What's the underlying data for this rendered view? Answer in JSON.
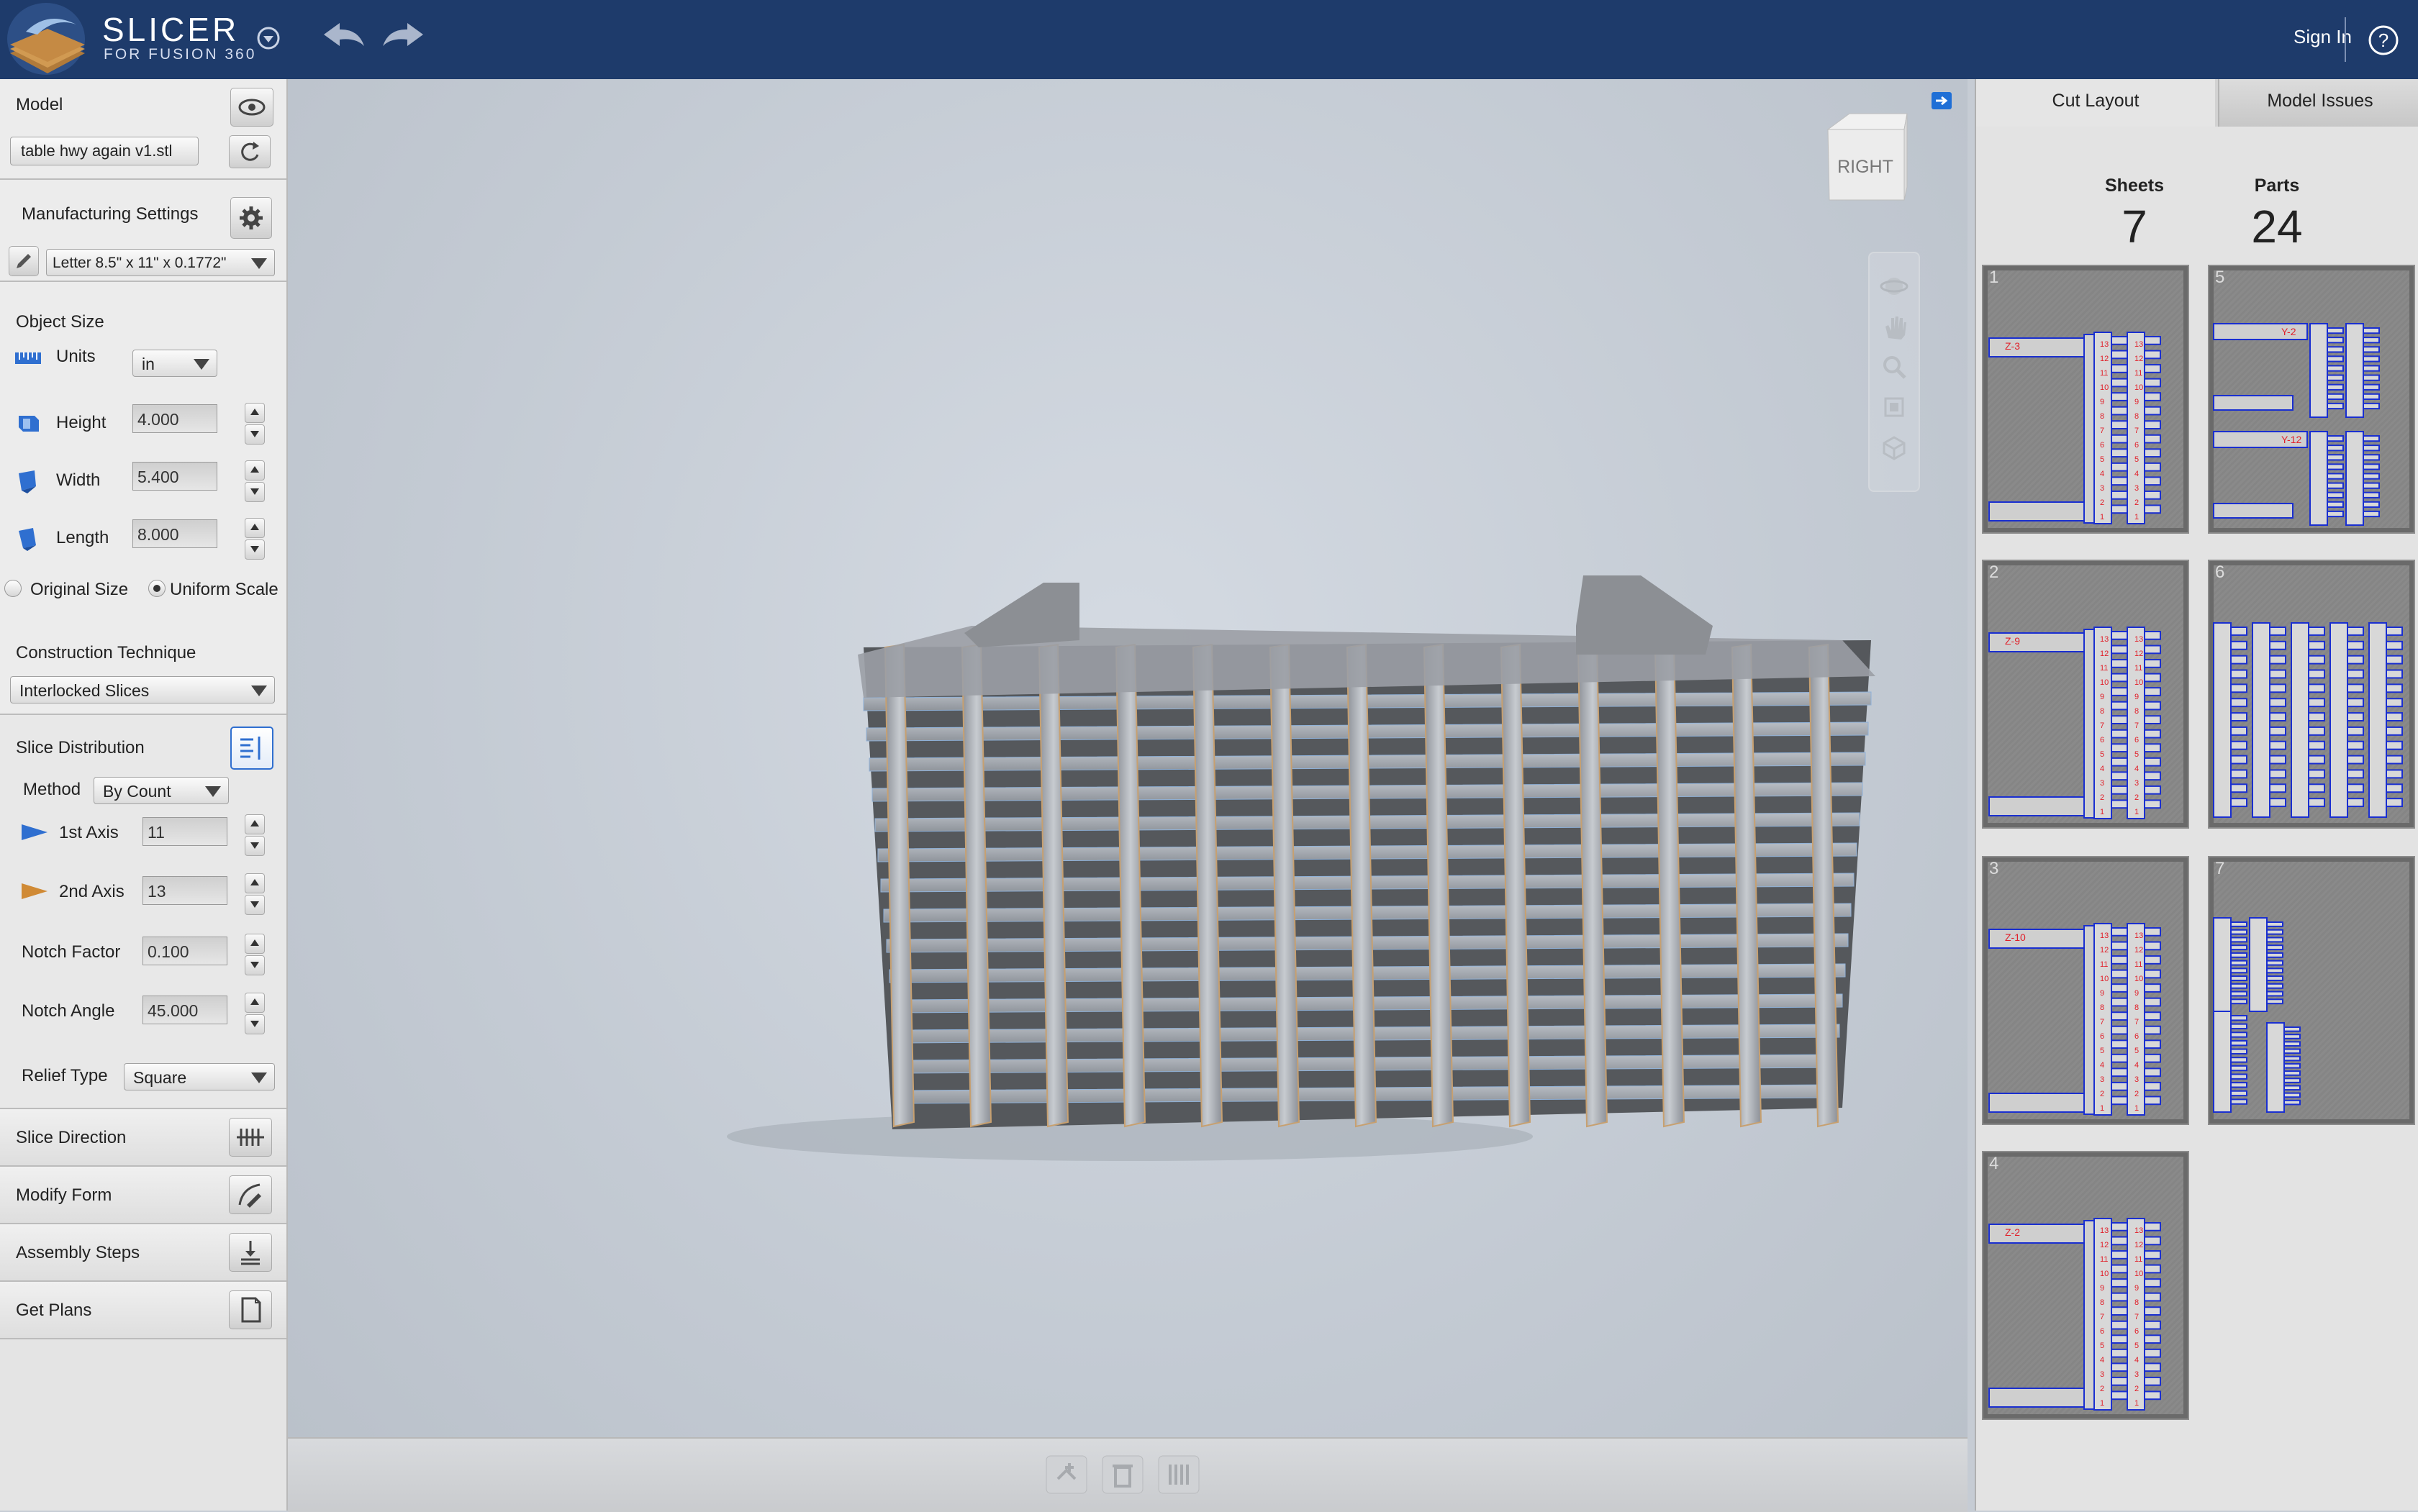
{
  "app": {
    "name": "SLICER",
    "subtitle": "FOR FUSION 360",
    "sign_in": "Sign In"
  },
  "model": {
    "label": "Model",
    "file": "table hwy again v1.stl"
  },
  "manufacturing": {
    "label": "Manufacturing Settings",
    "material": "Letter 8.5\" x 11\" x 0.1772\""
  },
  "object_size": {
    "label": "Object Size",
    "units_label": "Units",
    "units_value": "in",
    "height_label": "Height",
    "height_value": "4.000",
    "width_label": "Width",
    "width_value": "5.400",
    "length_label": "Length",
    "length_value": "8.000",
    "original_size": "Original Size",
    "uniform_scale": "Uniform Scale"
  },
  "construction": {
    "label": "Construction Technique",
    "value": "Interlocked Slices"
  },
  "slice_distribution": {
    "label": "Slice Distribution",
    "method_label": "Method",
    "method_value": "By Count",
    "axis1_label": "1st Axis",
    "axis1_value": "11",
    "axis2_label": "2nd Axis",
    "axis2_value": "13",
    "notch_factor_label": "Notch Factor",
    "notch_factor_value": "0.100",
    "notch_angle_label": "Notch Angle",
    "notch_angle_value": "45.000",
    "relief_type_label": "Relief Type",
    "relief_type_value": "Square"
  },
  "sections": {
    "slice_direction": "Slice Direction",
    "modify_form": "Modify Form",
    "assembly_steps": "Assembly Steps",
    "get_plans": "Get Plans"
  },
  "view_cube": {
    "face": "RIGHT"
  },
  "right_panel": {
    "tabs": [
      "Cut Layout",
      "Model Issues"
    ],
    "sheets_label": "Sheets",
    "sheets_value": "7",
    "parts_label": "Parts",
    "parts_value": "24",
    "sheets": [
      {
        "num": "1",
        "tag": "Z-3"
      },
      {
        "num": "5",
        "tag": "Y-2"
      },
      {
        "num": "2",
        "tag": "Z-9"
      },
      {
        "num": "6",
        "tag": ""
      },
      {
        "num": "3",
        "tag": "Z-10"
      },
      {
        "num": "7",
        "tag": ""
      },
      {
        "num": "4",
        "tag": "Z-2"
      }
    ]
  },
  "colors": {
    "topbar": "#1e3b6b",
    "accent": "#1f6fd6",
    "part_outline": "#1a2fd0",
    "part_label": "#e0202a"
  }
}
